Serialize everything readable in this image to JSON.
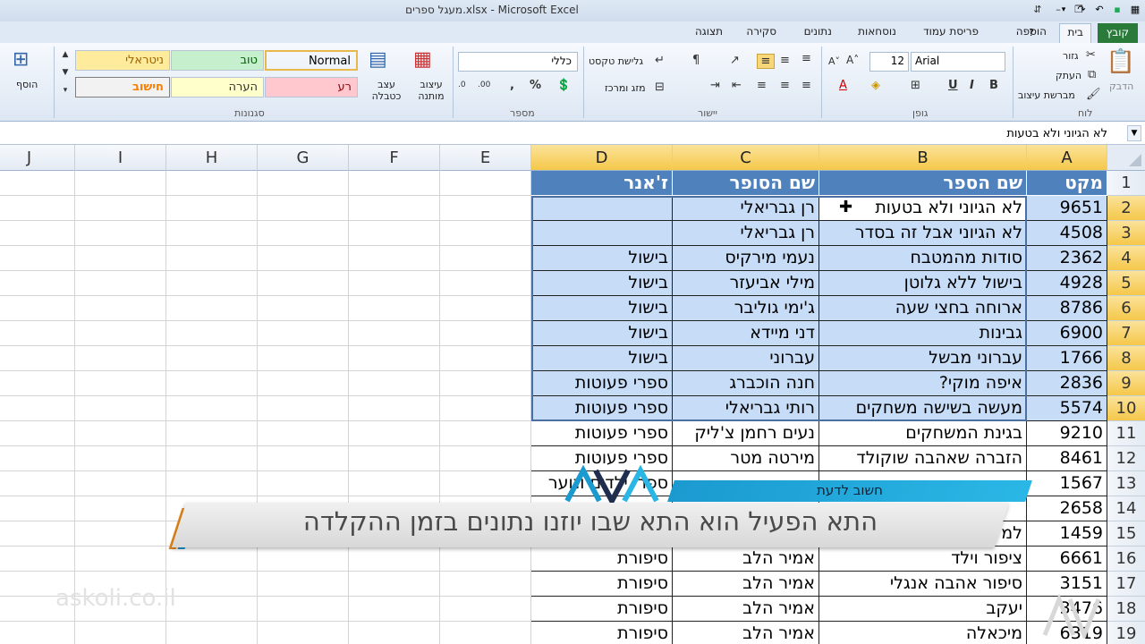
{
  "window": {
    "title": "מעגל ספרים.xlsx - Microsoft Excel"
  },
  "ribbon_tabs": [
    {
      "label": "קובץ",
      "id": "file"
    },
    {
      "label": "בית",
      "id": "home",
      "active": true
    },
    {
      "label": "הוספה",
      "id": "insert"
    },
    {
      "label": "פריסת עמוד",
      "id": "page-layout"
    },
    {
      "label": "נוסחאות",
      "id": "formulas"
    },
    {
      "label": "נתונים",
      "id": "data"
    },
    {
      "label": "סקירה",
      "id": "review"
    },
    {
      "label": "תצוגה",
      "id": "view"
    }
  ],
  "ribbon": {
    "clipboard": {
      "paste": "הדבק",
      "cut": "גזור",
      "copy": "העתק",
      "format_painter": "מברשת עיצוב",
      "label": "לוח"
    },
    "font": {
      "name": "Arial",
      "size": "12",
      "label": "גופן"
    },
    "alignment": {
      "wrap": "גלישת טקסט",
      "merge": "מזג ומרכז",
      "label": "יישור"
    },
    "number": {
      "format": "כללי",
      "label": "מספר"
    },
    "styles": {
      "conditional": "עיצוב מותנה",
      "as_table": "עצב כטבלה",
      "label": "סגנונות",
      "cells": [
        {
          "text": "Normal",
          "bg": "#ffffff"
        },
        {
          "text": "טוב",
          "bg": "#c6efce"
        },
        {
          "text": "ניטראלי",
          "bg": "#ffeb9c"
        },
        {
          "text": "רע",
          "bg": "#ffc7ce"
        },
        {
          "text": "הערה",
          "bg": "#ffffcc"
        },
        {
          "text": "חישוב",
          "bg": "#f2f2f2"
        }
      ]
    },
    "cells_group": {
      "insert": "הוסף"
    }
  },
  "formula_bar": {
    "content": "לא הגיוני ולא בטעות"
  },
  "columns": [
    "A",
    "B",
    "C",
    "D",
    "E",
    "F",
    "G",
    "H",
    "I",
    "J"
  ],
  "header_row": [
    "מקט",
    "שם הספר",
    "שם הסופר",
    "ז'אנר"
  ],
  "rows": [
    {
      "n": "2",
      "a": "9651",
      "b": "לא הגיוני ולא בטעות",
      "c": "רן גבריאלי",
      "d": ""
    },
    {
      "n": "3",
      "a": "4508",
      "b": "לא הגיוני אבל זה בסדר",
      "c": "רן גבריאלי",
      "d": ""
    },
    {
      "n": "4",
      "a": "2362",
      "b": "סודות מהמטבח",
      "c": "נעמי מירקיס",
      "d": "בישול"
    },
    {
      "n": "5",
      "a": "4928",
      "b": "בישול ללא גלוטן",
      "c": "מילי אביעזר",
      "d": "בישול"
    },
    {
      "n": "6",
      "a": "8786",
      "b": "ארוחה בחצי שעה",
      "c": "ג'ימי גוליבר",
      "d": "בישול"
    },
    {
      "n": "7",
      "a": "6900",
      "b": "גבינות",
      "c": "דני מיידא",
      "d": "בישול"
    },
    {
      "n": "8",
      "a": "1766",
      "b": "עברוני מבשל",
      "c": "עברוני",
      "d": "בישול"
    },
    {
      "n": "9",
      "a": "2836",
      "b": "איפה מוקי?",
      "c": "חנה הוכברג",
      "d": "ספרי פעוטות"
    },
    {
      "n": "10",
      "a": "5574",
      "b": "מעשה בשישה משחקים",
      "c": "רותי גבריאלי",
      "d": "ספרי פעוטות"
    },
    {
      "n": "11",
      "a": "9210",
      "b": "בגינת המשחקים",
      "c": "נעים רחמן צ'ליק",
      "d": "ספרי פעוטות"
    },
    {
      "n": "12",
      "a": "8461",
      "b": "הזברה שאהבה שוקולד",
      "c": "מירטה מטר",
      "d": "ספרי פעוטות"
    },
    {
      "n": "13",
      "a": "1567",
      "b": "",
      "c": "",
      "d": "ספרי ילדים ונוער"
    },
    {
      "n": "14",
      "a": "2658",
      "b": "",
      "c": "",
      "d": ""
    },
    {
      "n": "15",
      "a": "1459",
      "b": "למקו",
      "c": "",
      "d": ""
    },
    {
      "n": "16",
      "a": "6661",
      "b": "ציפור וילד",
      "c": "אמיר הלב",
      "d": "סיפורת"
    },
    {
      "n": "17",
      "a": "3151",
      "b": "סיפור אהבה אנגלי",
      "c": "אמיר הלב",
      "d": "סיפורת"
    },
    {
      "n": "18",
      "a": "3476",
      "b": "יעקב",
      "c": "אמיר הלב",
      "d": "סיפורת"
    },
    {
      "n": "19",
      "a": "6319",
      "b": "מיכאלה",
      "c": "אמיר הלב",
      "d": "סיפורת"
    }
  ],
  "overlay": {
    "tag": "חשוב לדעת",
    "message": "התא הפעיל הוא התא שבו יוזנו נתונים בזמן ההקלדה",
    "watermark": "askoli.co.il"
  },
  "colors": {
    "header_blue": "#4f81bd",
    "selection": "#c6dcf7",
    "selected_header": "#f5c84a",
    "banner_blue": "#1b9ad0"
  }
}
